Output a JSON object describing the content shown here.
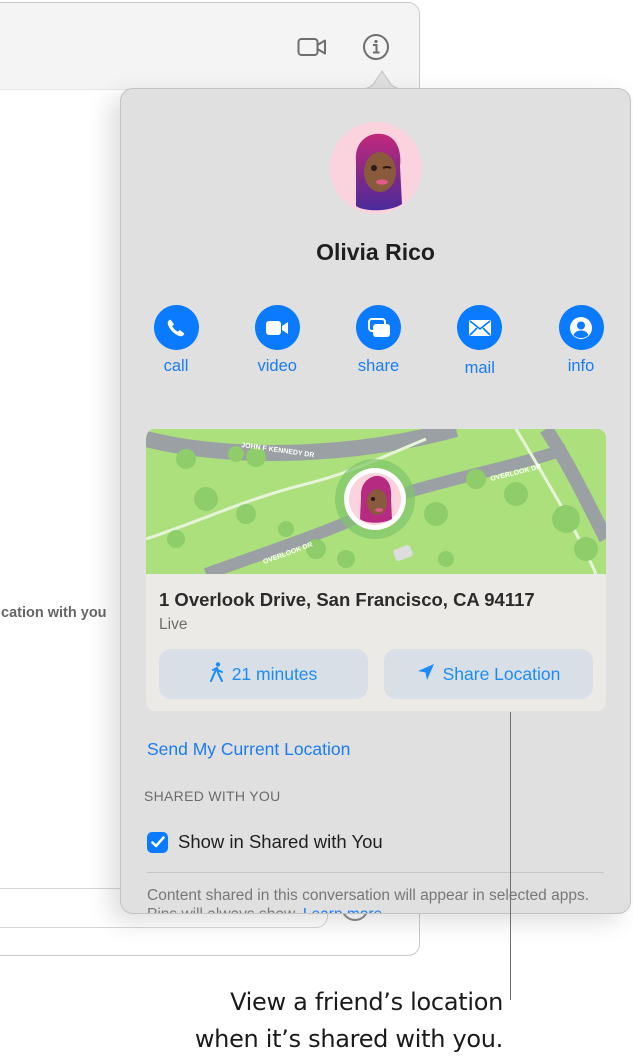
{
  "background_window": {
    "toolbar_icons": [
      "video-camera-icon",
      "info-icon"
    ],
    "partial_text": "cation with you"
  },
  "popover": {
    "contact_name": "Olivia Rico",
    "avatar": "memoji-avatar",
    "actions": [
      {
        "label": "call",
        "icon": "phone-icon"
      },
      {
        "label": "video",
        "icon": "video-icon"
      },
      {
        "label": "share",
        "icon": "share-screen-icon"
      },
      {
        "label": "mail",
        "icon": "mail-icon"
      },
      {
        "label": "info",
        "icon": "person-icon"
      }
    ],
    "location_card": {
      "map_labels": [
        "JOHN F KENNEDY DR",
        "OVERLOOK DR",
        "OVERLOOK DR"
      ],
      "address": "1 Overlook Drive, San Francisco, CA 94117",
      "status": "Live",
      "walk_button": "21 minutes",
      "share_button": "Share Location"
    },
    "send_location_link": "Send My Current Location",
    "shared_section_header": "SHARED WITH YOU",
    "show_in_shared_label": "Show in Shared with You",
    "show_in_shared_checked": true,
    "footnote_text": "Content shared in this conversation will appear in selected apps. Pins will always show.",
    "footnote_link": "Learn more"
  },
  "callout": {
    "line1": "View a friend’s location",
    "line2": "when it’s shared with you."
  },
  "colors": {
    "accent": "#0a7aff",
    "link": "#1a7cf0",
    "popover_bg": "#e0e0e0",
    "map_green": "#a9dd7b"
  }
}
